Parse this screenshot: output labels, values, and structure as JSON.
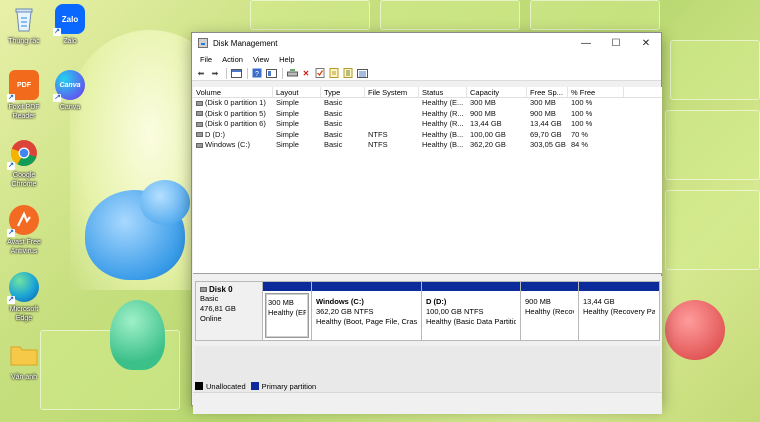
{
  "desktop": {
    "icons": [
      {
        "label": "Thùng rác",
        "icon": "recycle-bin-icon"
      },
      {
        "label": "Zalo",
        "icon": "zalo-icon",
        "glyph": "Zalo"
      },
      {
        "label": "Foxit PDF Reader",
        "icon": "foxit-pdf-icon",
        "glyph": "PDF"
      },
      {
        "label": "Canva",
        "icon": "canva-icon",
        "glyph": "Canva"
      },
      {
        "label": "Google Chrome",
        "icon": "chrome-icon"
      },
      {
        "label": "Avast Free Antivirus",
        "icon": "avast-icon"
      },
      {
        "label": "Microsoft Edge",
        "icon": "edge-icon"
      },
      {
        "label": "Văn anh",
        "icon": "folder-icon"
      }
    ]
  },
  "window": {
    "title": "Disk Management",
    "controls": {
      "minimize": "—",
      "maximize": "☐",
      "close": "✕"
    }
  },
  "menu": [
    "File",
    "Action",
    "View",
    "Help"
  ],
  "volume_table": {
    "columns": [
      "Volume",
      "Layout",
      "Type",
      "File System",
      "Status",
      "Capacity",
      "Free Sp...",
      "% Free"
    ],
    "rows": [
      [
        "(Disk 0 partition 1)",
        "Simple",
        "Basic",
        "",
        "Healthy (E...",
        "300 MB",
        "300 MB",
        "100 %"
      ],
      [
        "(Disk 0 partition 5)",
        "Simple",
        "Basic",
        "",
        "Healthy (R...",
        "900 MB",
        "900 MB",
        "100 %"
      ],
      [
        "(Disk 0 partition 6)",
        "Simple",
        "Basic",
        "",
        "Healthy (R...",
        "13,44 GB",
        "13,44 GB",
        "100 %"
      ],
      [
        "D (D:)",
        "Simple",
        "Basic",
        "NTFS",
        "Healthy (B...",
        "100,00 GB",
        "69,70 GB",
        "70 %"
      ],
      [
        "Windows (C:)",
        "Simple",
        "Basic",
        "NTFS",
        "Healthy (B...",
        "362,20 GB",
        "303,05 GB",
        "84 %"
      ]
    ]
  },
  "disk": {
    "name": "Disk 0",
    "type": "Basic",
    "size": "476,81 GB",
    "status": "Online",
    "partitions": [
      {
        "name": "",
        "size": "300 MB",
        "status": "Healthy (EFI"
      },
      {
        "name": "Windows  (C:)",
        "size": "362,20 GB NTFS",
        "status": "Healthy (Boot, Page File, Crash"
      },
      {
        "name": "D  (D:)",
        "size": "100,00 GB NTFS",
        "status": "Healthy (Basic Data Partitic"
      },
      {
        "name": "",
        "size": "900 MB",
        "status": "Healthy (Recov"
      },
      {
        "name": "",
        "size": "13,44 GB",
        "status": "Healthy (Recovery Par"
      }
    ]
  },
  "legend": {
    "unallocated": "Unallocated",
    "primary": "Primary partition",
    "unallocated_color": "#000000",
    "primary_color": "#0b2b9a"
  }
}
